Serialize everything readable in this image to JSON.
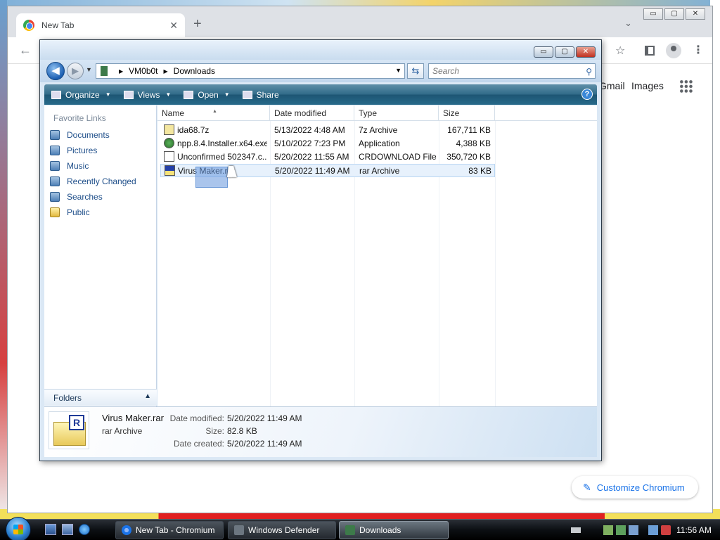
{
  "chrome": {
    "tab_title": "New Tab",
    "new_tab": "+",
    "close": "✕",
    "back": "←",
    "tab_search": "⌄",
    "star": "☆",
    "menu": "⋮",
    "win_min": "▭",
    "win_max": "▢",
    "win_close": "✕",
    "gmail": "Gmail",
    "images": "Images",
    "customize": "Customize Chromium"
  },
  "explorer": {
    "win_min": "▭",
    "win_max": "▢",
    "win_close": "✕",
    "back": "◀",
    "forward": "▶",
    "address": {
      "root": "VM0b0t",
      "folder": "Downloads"
    },
    "search_placeholder": "Search",
    "toolbar": {
      "organize": "Organize",
      "views": "Views",
      "open": "Open",
      "share": "Share",
      "help": "?"
    },
    "nav": {
      "title": "Favorite Links",
      "items": [
        "Documents",
        "Pictures",
        "Music",
        "Recently Changed",
        "Searches",
        "Public"
      ],
      "folders": "Folders"
    },
    "columns": [
      "Name",
      "Date modified",
      "Type",
      "Size"
    ],
    "files": [
      {
        "name": "ida68.7z",
        "date": "5/13/2022 4:48 AM",
        "type": "7z Archive",
        "size": "167,711 KB",
        "icon": "7z-archive-icon"
      },
      {
        "name": "npp.8.4.Installer.x64.exe",
        "date": "5/10/2022 7:23 PM",
        "type": "Application",
        "size": "4,388 KB",
        "icon": "installer-icon"
      },
      {
        "name": "Unconfirmed 502347.c...",
        "date": "5/20/2022 11:55 AM",
        "type": "CRDOWNLOAD File",
        "size": "350,720 KB",
        "icon": "blank-file-icon"
      },
      {
        "name": "Virus Maker.rar",
        "date": "5/20/2022 11:49 AM",
        "type": "rar Archive",
        "size": "83 KB",
        "icon": "rar-archive-icon",
        "selected": true
      }
    ],
    "details": {
      "filename": "Virus Maker.rar",
      "filetype": "rar Archive",
      "date_modified_label": "Date modified:",
      "date_modified": "5/20/2022 11:49 AM",
      "size_label": "Size:",
      "size": "82.8 KB",
      "date_created_label": "Date created:",
      "date_created": "5/20/2022 11:49 AM",
      "badge": "R"
    }
  },
  "taskbar": {
    "tasks": [
      "New Tab - Chromium",
      "Windows Defender",
      "Downloads"
    ],
    "clock": "11:56 AM"
  }
}
